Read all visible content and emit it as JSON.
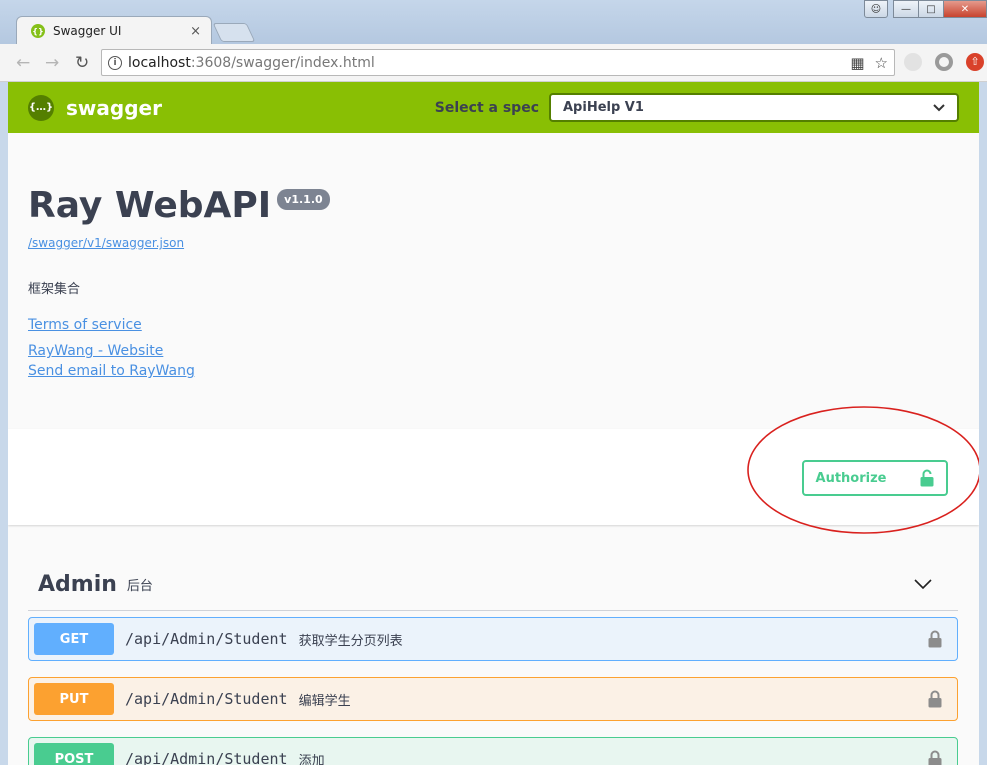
{
  "browser": {
    "tab_title": "Swagger UI",
    "tab_close": "×",
    "url_host": "localhost",
    "url_rest": ":3608/swagger/index.html",
    "back": "←",
    "forward": "→",
    "refresh": "C"
  },
  "topbar": {
    "logo_text": "swagger",
    "logo_glyph": "{…}",
    "spec_label": "Select a spec",
    "spec_value": "ApiHelp V1"
  },
  "info": {
    "title": "Ray WebAPI",
    "version": "v1.1.0",
    "spec_url": "/swagger/v1/swagger.json",
    "description": "框架集合",
    "terms": "Terms of service",
    "website": "RayWang - Website",
    "email": "Send email to RayWang"
  },
  "scheme": {
    "authorize_label": "Authorize"
  },
  "tag": {
    "name": "Admin",
    "description": "后台"
  },
  "operations": [
    {
      "method": "GET",
      "path": "/api/Admin/Student",
      "summary": "获取学生分页列表"
    },
    {
      "method": "PUT",
      "path": "/api/Admin/Student",
      "summary": "编辑学生"
    },
    {
      "method": "POST",
      "path": "/api/Admin/Student",
      "summary": "添加"
    }
  ],
  "colors": {
    "brand": "#89bf04",
    "get": "#61affe",
    "put": "#fca130",
    "post": "#49cc90",
    "annotation": "#d9211e"
  }
}
